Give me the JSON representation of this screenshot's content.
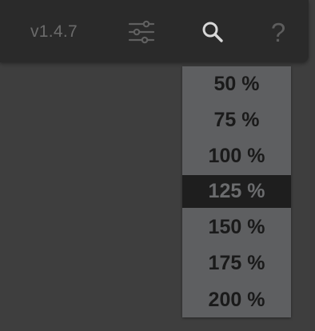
{
  "toolbar": {
    "version": "v1.4.7",
    "settings_icon": "sliders-icon",
    "search_icon": "search-icon",
    "help_glyph": "?"
  },
  "zoom_menu": {
    "selected": "125 %",
    "items": [
      "50 %",
      "75 %",
      "100 %",
      "125 %",
      "150 %",
      "175 %",
      "200 %"
    ]
  },
  "colors": {
    "background": "#3e3e3e",
    "toolbar": "#2a2a2a",
    "menu": "#5e5f61",
    "selected_item": "#1e1e1e",
    "icon_active": "#d8d8d8",
    "icon_muted": "#5d5d5d"
  }
}
